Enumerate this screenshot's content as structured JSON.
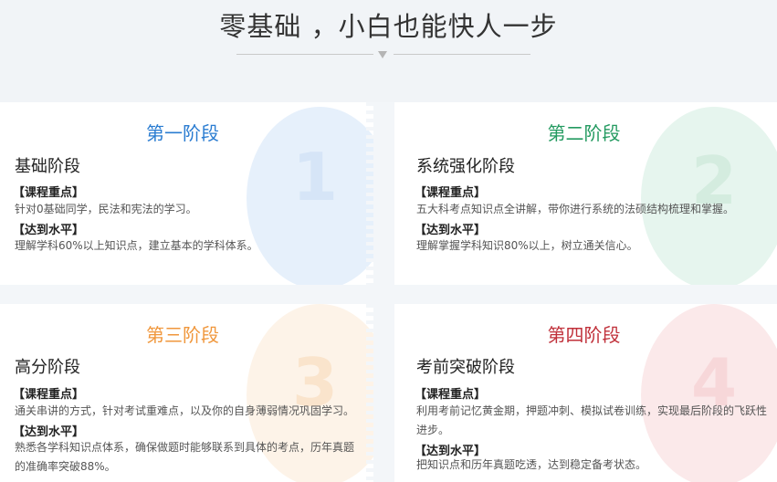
{
  "header": {
    "title": "零基础 ，小白也能快人一步"
  },
  "cards": [
    {
      "stage": "第一阶段",
      "number": "1",
      "name": "基础阶段",
      "focus_label": "【课程重点】",
      "focus_text": "针对0基础同学，民法和宪法的学习。",
      "level_label": "【达到水平】",
      "level_text": "理解学科60%以上知识点，建立基本的学科体系。",
      "accent": "#2a7cd1"
    },
    {
      "stage": "第二阶段",
      "number": "2",
      "name": "系统强化阶段",
      "focus_label": "【课程重点】",
      "focus_text": "五大科考点知识点全讲解，带你进行系统的法硕结构梳理和掌握。",
      "level_label": "【达到水平】",
      "level_text": "理解掌握学科知识80%以上，树立通关信心。",
      "accent": "#239a60"
    },
    {
      "stage": "第三阶段",
      "number": "3",
      "name": "高分阶段",
      "focus_label": "【课程重点】",
      "focus_text": "通关串讲的方式，针对考试重难点，以及你的自身薄弱情况巩固学习。",
      "level_label": "【达到水平】",
      "level_text": "熟悉各学科知识点体系，确保做题时能够联系到具体的考点，历年真题的准确率突破88%。",
      "accent": "#f0973c"
    },
    {
      "stage": "第四阶段",
      "number": "4",
      "name": "考前突破阶段",
      "focus_label": "【课程重点】",
      "focus_text": "利用考前记忆黄金期，押题冲刺、模拟试卷训练，实现最后阶段的飞跃性进步。",
      "level_label": "【达到水平】",
      "level_text": "把知识点和历年真题吃透，达到稳定备考状态。",
      "accent": "#c0303a"
    }
  ]
}
